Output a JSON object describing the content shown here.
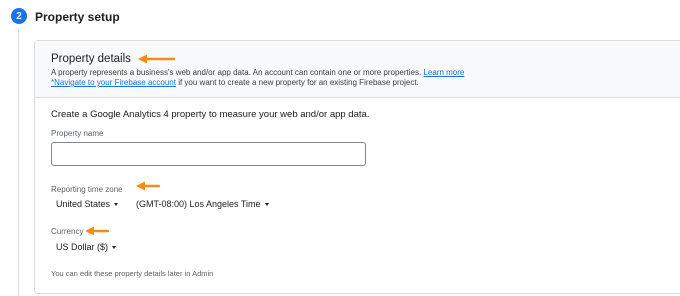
{
  "step": {
    "number": "2",
    "title": "Property setup"
  },
  "property_details": {
    "title": "Property details",
    "description_line1": "A property represents a business's web and/or app data. An account can contain one or more properties.",
    "learn_more": "Learn more",
    "navigate_link": "*Navigate to your Firebase account",
    "description_line2_rest": " if you want to create a new property for an existing Firebase project."
  },
  "form": {
    "intro": "Create a Google Analytics 4 property to measure your web and/or app data.",
    "property_name_label": "Property name",
    "property_name_value": "",
    "timezone_label": "Reporting time zone",
    "country": "United States",
    "timezone": "(GMT-08:00) Los Angeles Time",
    "currency_label": "Currency",
    "currency": "US Dollar ($)",
    "hint": "You can edit these property details later in Admin"
  },
  "colors": {
    "accent": "#1a73e8",
    "annotation_arrow": "#f28c1a"
  },
  "icons": [
    "caret-down-icon",
    "arrow-annotation-icon"
  ]
}
